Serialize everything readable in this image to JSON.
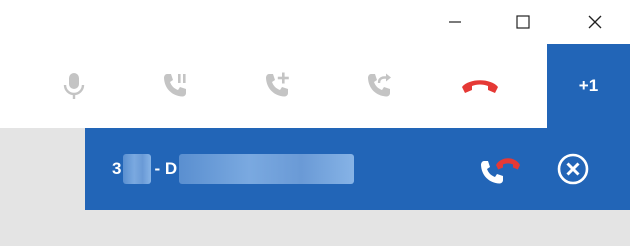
{
  "window": {
    "controls": {
      "minimize_icon": "minimize-icon",
      "maximize_icon": "maximize-icon",
      "close_icon": "close-icon"
    }
  },
  "toolbar": {
    "buttons": [
      {
        "id": "mute",
        "icon": "microphone-icon",
        "state": "disabled"
      },
      {
        "id": "hold",
        "icon": "phone-hold-icon",
        "state": "disabled"
      },
      {
        "id": "add-call",
        "icon": "phone-add-icon",
        "state": "disabled"
      },
      {
        "id": "transfer",
        "icon": "phone-transfer-icon",
        "state": "disabled"
      },
      {
        "id": "hang-up",
        "icon": "hang-up-icon",
        "state": "enabled"
      }
    ],
    "plus_tab_label": "+1"
  },
  "call": {
    "caller_prefix": "3",
    "caller_separator": "- D",
    "swap_icon": "phone-swap-icon",
    "remove_icon": "circle-x-icon"
  },
  "colors": {
    "accent": "#2265b7",
    "hangup_red": "#e53935",
    "disabled_gray": "#c4c4c4",
    "white": "#ffffff"
  }
}
